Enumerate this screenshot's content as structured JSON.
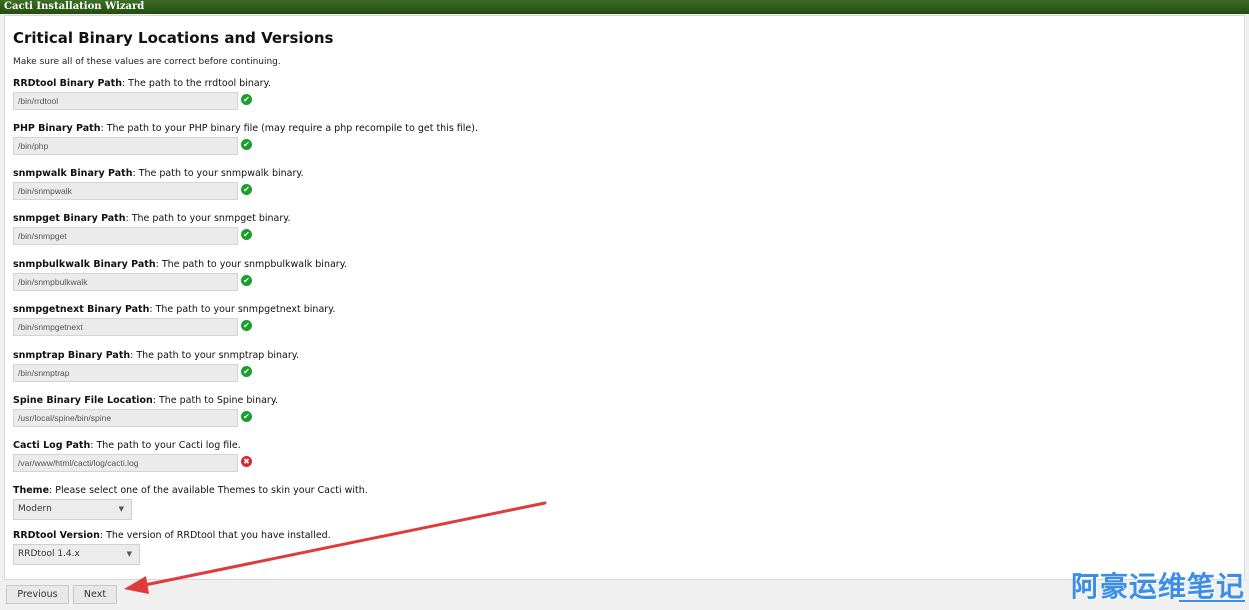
{
  "window": {
    "title": "Cacti Installation Wizard"
  },
  "page": {
    "heading": "Critical Binary Locations and Versions",
    "intro": "Make sure all of these values are correct before continuing."
  },
  "fields": [
    {
      "name": "RRDtool Binary Path",
      "description": ": The path to the rrdtool binary.",
      "value": "/bin/rrdtool",
      "status": "ok"
    },
    {
      "name": "PHP Binary Path",
      "description": ": The path to your PHP binary file (may require a php recompile to get this file).",
      "value": "/bin/php",
      "status": "ok"
    },
    {
      "name": "snmpwalk Binary Path",
      "description": ": The path to your snmpwalk binary.",
      "value": "/bin/snmpwalk",
      "status": "ok"
    },
    {
      "name": "snmpget Binary Path",
      "description": ": The path to your snmpget binary.",
      "value": "/bin/snmpget",
      "status": "ok"
    },
    {
      "name": "snmpbulkwalk Binary Path",
      "description": ": The path to your snmpbulkwalk binary.",
      "value": "/bin/snmpbulkwalk",
      "status": "ok"
    },
    {
      "name": "snmpgetnext Binary Path",
      "description": ": The path to your snmpgetnext binary.",
      "value": "/bin/snmpgetnext",
      "status": "ok"
    },
    {
      "name": "snmptrap Binary Path",
      "description": ": The path to your snmptrap binary.",
      "value": "/bin/snmptrap",
      "status": "ok"
    },
    {
      "name": "Spine Binary File Location",
      "description": ": The path to Spine binary.",
      "value": "/usr/local/spine/bin/spine",
      "status": "ok"
    },
    {
      "name": "Cacti Log Path",
      "description": ": The path to your Cacti log file.",
      "value": "/var/www/html/cacti/log/cacti.log",
      "status": "error"
    }
  ],
  "theme": {
    "name": "Theme",
    "description": ": Please select one of the available Themes to skin your Cacti with.",
    "selected": "Modern"
  },
  "rrdtool_version": {
    "name": "RRDtool Version",
    "description": ": The version of RRDtool that you have installed.",
    "selected": "RRDtool 1.4.x"
  },
  "buttons": {
    "previous": "Previous",
    "next": "Next"
  },
  "status_icons": {
    "ok": "✔",
    "error": "✖"
  },
  "colors": {
    "titlebar": "#2f5e1a",
    "ok": "#1a9e2d",
    "error": "#d6262e",
    "annotation_arrow": "#e03a3a",
    "watermark": "#3d8fe6"
  },
  "watermark": "阿豪运维笔记"
}
